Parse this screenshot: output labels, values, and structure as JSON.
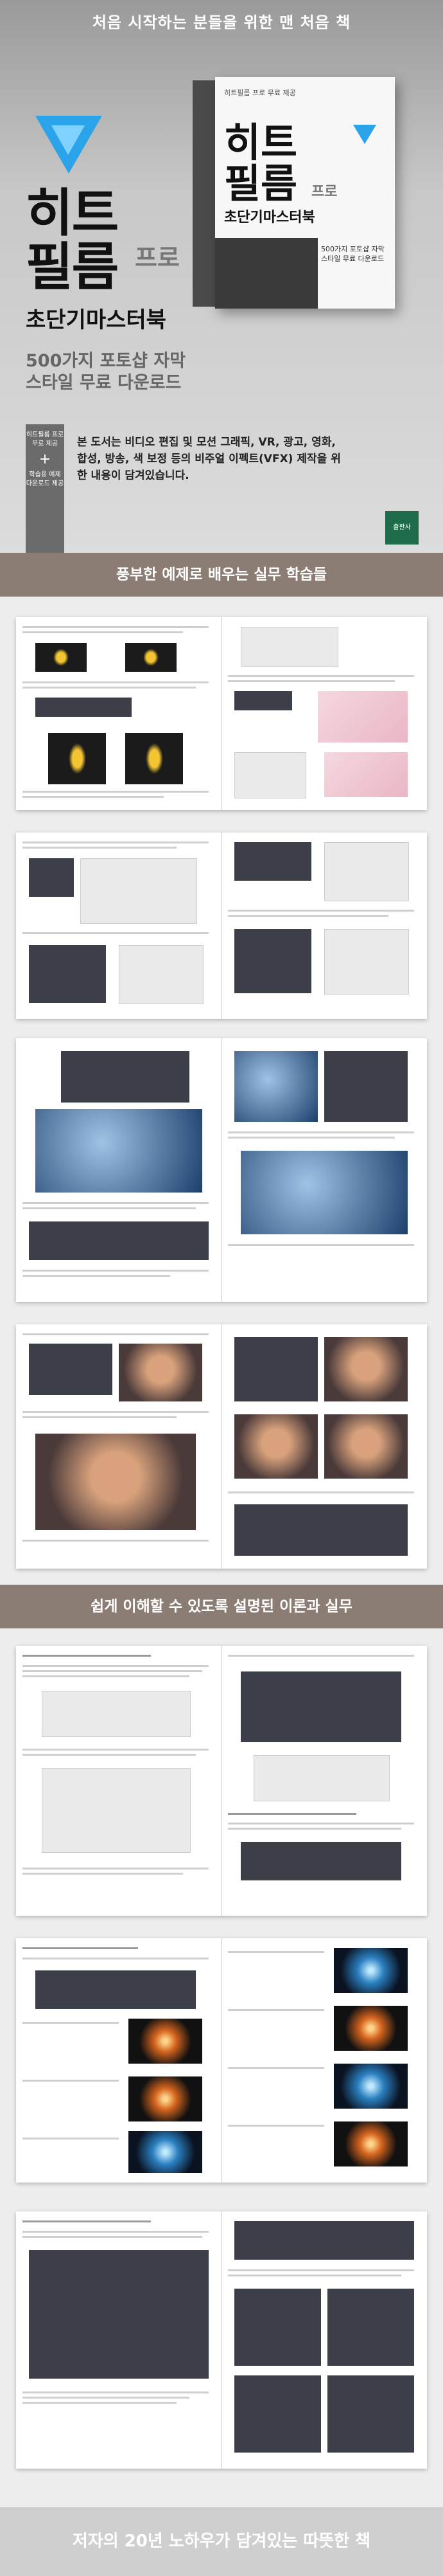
{
  "hero": {
    "banner": "처음 시작하는 분들을 위한 맨 처음 책",
    "title": "히트\n필름",
    "pro": "프로",
    "subtitle": "초단기마스터북",
    "feature": "500가지 포토샵 자막\n스타일 무료 다운로드",
    "promo": {
      "line1": "히트필름 프로 무료 제공",
      "plus": "+",
      "line2": "학습용 예제 다운로드 제공"
    },
    "description": "본 도서는 비디오 편집 및 모션 그래픽, VR, 광고, 영화, 합성, 방송, 색 보정 등의 비주얼 이펙트(VFX) 제작을 위한 내용이 담겨있습니다.",
    "book": {
      "top": "히트필름 프로 무료 제공",
      "title": "히트\n필름",
      "pro": "프로",
      "subtitle": "초단기마스터북",
      "feature": "500가지 포토샵 자막 스타일 무료 다운로드"
    },
    "badge": "출판사"
  },
  "sections": {
    "examples_title": "풍부한 예제로 배우는 실무 학습들",
    "theory_title": "쉽게 이해할 수 있도록 설명된 이론과 실무",
    "footer_title": "저자의 20년 노하우가 담겨있는 따뜻한 책"
  }
}
